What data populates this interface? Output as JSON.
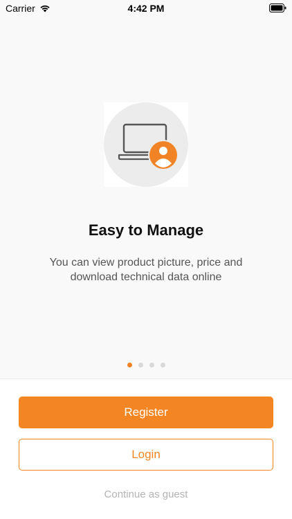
{
  "status_bar": {
    "carrier": "Carrier",
    "time": "4:42 PM",
    "wifi_icon": "wifi-icon",
    "battery_icon": "battery-icon"
  },
  "onboarding": {
    "illustration_icon": "laptop-user-icon",
    "title": "Easy to Manage",
    "description": "You can view product picture, price and download technical data online",
    "page_count": 4,
    "active_page": 1
  },
  "actions": {
    "register_label": "Register",
    "login_label": "Login",
    "guest_label": "Continue as guest"
  },
  "colors": {
    "accent": "#f38522",
    "background": "#f9f9f9",
    "inactive_dot": "#d9d9d9",
    "guest_text": "#b3b3b3"
  }
}
